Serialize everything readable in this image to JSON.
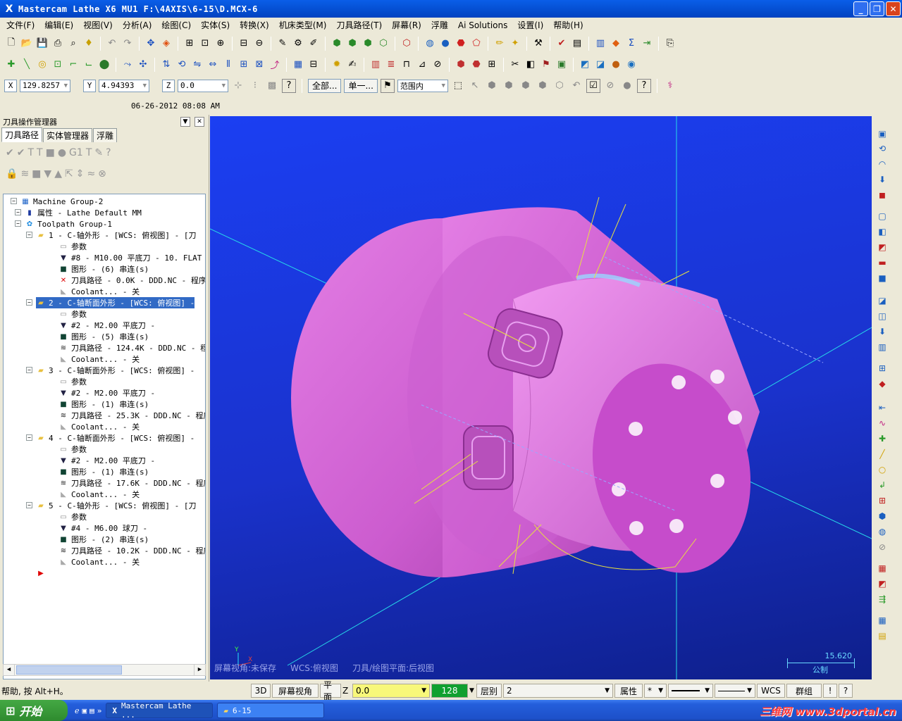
{
  "title": "Mastercam Lathe X6 MU1  F:\\4AXIS\\6-15\\D.MCX-6",
  "menu": [
    "文件(F)",
    "编辑(E)",
    "视图(V)",
    "分析(A)",
    "绘图(C)",
    "实体(S)",
    "转换(X)",
    "机床类型(M)",
    "刀具路径(T)",
    "屏幕(R)",
    "浮雕",
    "Ai Solutions",
    "设置(I)",
    "帮助(H)"
  ],
  "coords": {
    "x_label": "X",
    "x_value": "129.8257",
    "y_label": "Y",
    "y_value": "4.94393",
    "z_label": "Z",
    "z_value": "0.0"
  },
  "select": {
    "all": "全部...",
    "single": "单一...",
    "range": "范围内"
  },
  "date": "06-26-2012 08:08 AM",
  "panel": {
    "title": "刀具操作管理器",
    "tabs": [
      "刀具路径",
      "实体管理器",
      "浮雕"
    ],
    "tree": [
      {
        "text": "Machine Group-2",
        "indent": 0,
        "icon": "machine-group-icon",
        "glyph": "▦",
        "color": "#1e64c8"
      },
      {
        "text": "属性 - Lathe Default MM",
        "indent": 1,
        "icon": "properties-icon",
        "glyph": "▮",
        "color": "#1e3aa0"
      },
      {
        "text": "Toolpath Group-1",
        "indent": 1,
        "icon": "toolpath-group-icon",
        "glyph": "✿",
        "color": "#1e8ce0"
      },
      {
        "text": "1 - C-轴外形 - [WCS: 俯视图] - [刀",
        "indent": 2,
        "icon": "folder-open-icon",
        "glyph": "▰",
        "color": "#e8c040"
      },
      {
        "text": "参数",
        "indent": 3,
        "icon": "folder-icon",
        "glyph": "▭",
        "color": "#888"
      },
      {
        "text": "#8 - M10.00 平底刀 -  10. FLAT",
        "indent": 3,
        "icon": "tool-icon",
        "glyph": "▼",
        "color": "#224"
      },
      {
        "text": "图形 - (6) 串连(s)",
        "indent": 3,
        "icon": "geometry-icon",
        "glyph": "■",
        "color": "#143"
      },
      {
        "text": "刀具路径 - 0.0K - DDD.NC - 程序",
        "indent": 3,
        "icon": "toolpath-dirty-icon",
        "glyph": "✕",
        "color": "#d00"
      },
      {
        "text": "Coolant... - 关",
        "indent": 3,
        "icon": "coolant-icon",
        "glyph": "◣",
        "color": "#aaa"
      },
      {
        "text": "2 - C-轴断面外形 - [WCS: 俯视图] -",
        "indent": 2,
        "icon": "folder-open-icon",
        "glyph": "▰",
        "color": "#e8c040",
        "selected": true
      },
      {
        "text": "参数",
        "indent": 3,
        "icon": "folder-icon",
        "glyph": "▭",
        "color": "#888"
      },
      {
        "text": "#2 - M2.00 平底刀 -",
        "indent": 3,
        "icon": "tool-icon",
        "glyph": "▼",
        "color": "#224"
      },
      {
        "text": "图形 - (5) 串连(s)",
        "indent": 3,
        "icon": "geometry-icon",
        "glyph": "■",
        "color": "#143"
      },
      {
        "text": "刀具路径 - 124.4K - DDD.NC - 程",
        "indent": 3,
        "icon": "toolpath-icon",
        "glyph": "≋",
        "color": "#222"
      },
      {
        "text": "Coolant... - 关",
        "indent": 3,
        "icon": "coolant-icon",
        "glyph": "◣",
        "color": "#aaa"
      },
      {
        "text": "3 - C-轴断面外形 - [WCS: 俯视图] -",
        "indent": 2,
        "icon": "folder-open-icon",
        "glyph": "▰",
        "color": "#e8c040"
      },
      {
        "text": "参数",
        "indent": 3,
        "icon": "folder-icon",
        "glyph": "▭",
        "color": "#888"
      },
      {
        "text": "#2 - M2.00 平底刀 -",
        "indent": 3,
        "icon": "tool-icon",
        "glyph": "▼",
        "color": "#224"
      },
      {
        "text": "图形 - (1) 串连(s)",
        "indent": 3,
        "icon": "geometry-icon",
        "glyph": "■",
        "color": "#143"
      },
      {
        "text": "刀具路径 - 25.3K - DDD.NC - 程序",
        "indent": 3,
        "icon": "toolpath-icon",
        "glyph": "≋",
        "color": "#222"
      },
      {
        "text": "Coolant... - 关",
        "indent": 3,
        "icon": "coolant-icon",
        "glyph": "◣",
        "color": "#aaa"
      },
      {
        "text": "4 - C-轴断面外形 - [WCS: 俯视图] -",
        "indent": 2,
        "icon": "folder-open-icon",
        "glyph": "▰",
        "color": "#e8c040"
      },
      {
        "text": "参数",
        "indent": 3,
        "icon": "folder-icon",
        "glyph": "▭",
        "color": "#888"
      },
      {
        "text": "#2 - M2.00 平底刀 -",
        "indent": 3,
        "icon": "tool-icon",
        "glyph": "▼",
        "color": "#224"
      },
      {
        "text": "图形 - (1) 串连(s)",
        "indent": 3,
        "icon": "geometry-icon",
        "glyph": "■",
        "color": "#143"
      },
      {
        "text": "刀具路径 - 17.6K - DDD.NC - 程序",
        "indent": 3,
        "icon": "toolpath-icon",
        "glyph": "≋",
        "color": "#222"
      },
      {
        "text": "Coolant... - 关",
        "indent": 3,
        "icon": "coolant-icon",
        "glyph": "◣",
        "color": "#aaa"
      },
      {
        "text": "5 - C-轴外形 - [WCS: 俯视图] - [刀",
        "indent": 2,
        "icon": "folder-open-icon",
        "glyph": "▰",
        "color": "#e8c040"
      },
      {
        "text": "参数",
        "indent": 3,
        "icon": "folder-icon",
        "glyph": "▭",
        "color": "#888"
      },
      {
        "text": "#4 - M6.00 球刀 -",
        "indent": 3,
        "icon": "tool-icon",
        "glyph": "▼",
        "color": "#224"
      },
      {
        "text": "图形 - (2) 串连(s)",
        "indent": 3,
        "icon": "geometry-icon",
        "glyph": "■",
        "color": "#143"
      },
      {
        "text": "刀具路径 - 10.2K - DDD.NC - 程序",
        "indent": 3,
        "icon": "toolpath-icon",
        "glyph": "≋",
        "color": "#222"
      },
      {
        "text": "Coolant... - 关",
        "indent": 3,
        "icon": "coolant-icon",
        "glyph": "◣",
        "color": "#aaa"
      },
      {
        "text": "",
        "indent": 2,
        "icon": "insert-arrow-icon",
        "glyph": "▶",
        "color": "#e00000"
      }
    ]
  },
  "viewport": {
    "status": [
      "屏幕视角:未保存",
      "WCS:俯视图",
      "刀具/绘图平面:后视图"
    ],
    "scale_value": "15.620",
    "scale_unit": "公制",
    "part_color": "#e070e0",
    "bg_color": "#1b3ff2"
  },
  "statusbar": {
    "help": "帮助, 按 Alt+H。",
    "mode": "3D",
    "screen_view": "屏幕视角",
    "plane": "平面",
    "z_label": "Z",
    "z_value": "0.0",
    "color_value": "128",
    "layer_label": "层别",
    "layer_value": "2",
    "attr": "属性",
    "wcs": "WCS",
    "group": "群组"
  },
  "taskbar": {
    "start": "开始",
    "items": [
      "Mastercam Lathe ...",
      "6-15"
    ],
    "watermark": "三维网 www.3dportal.cn"
  }
}
